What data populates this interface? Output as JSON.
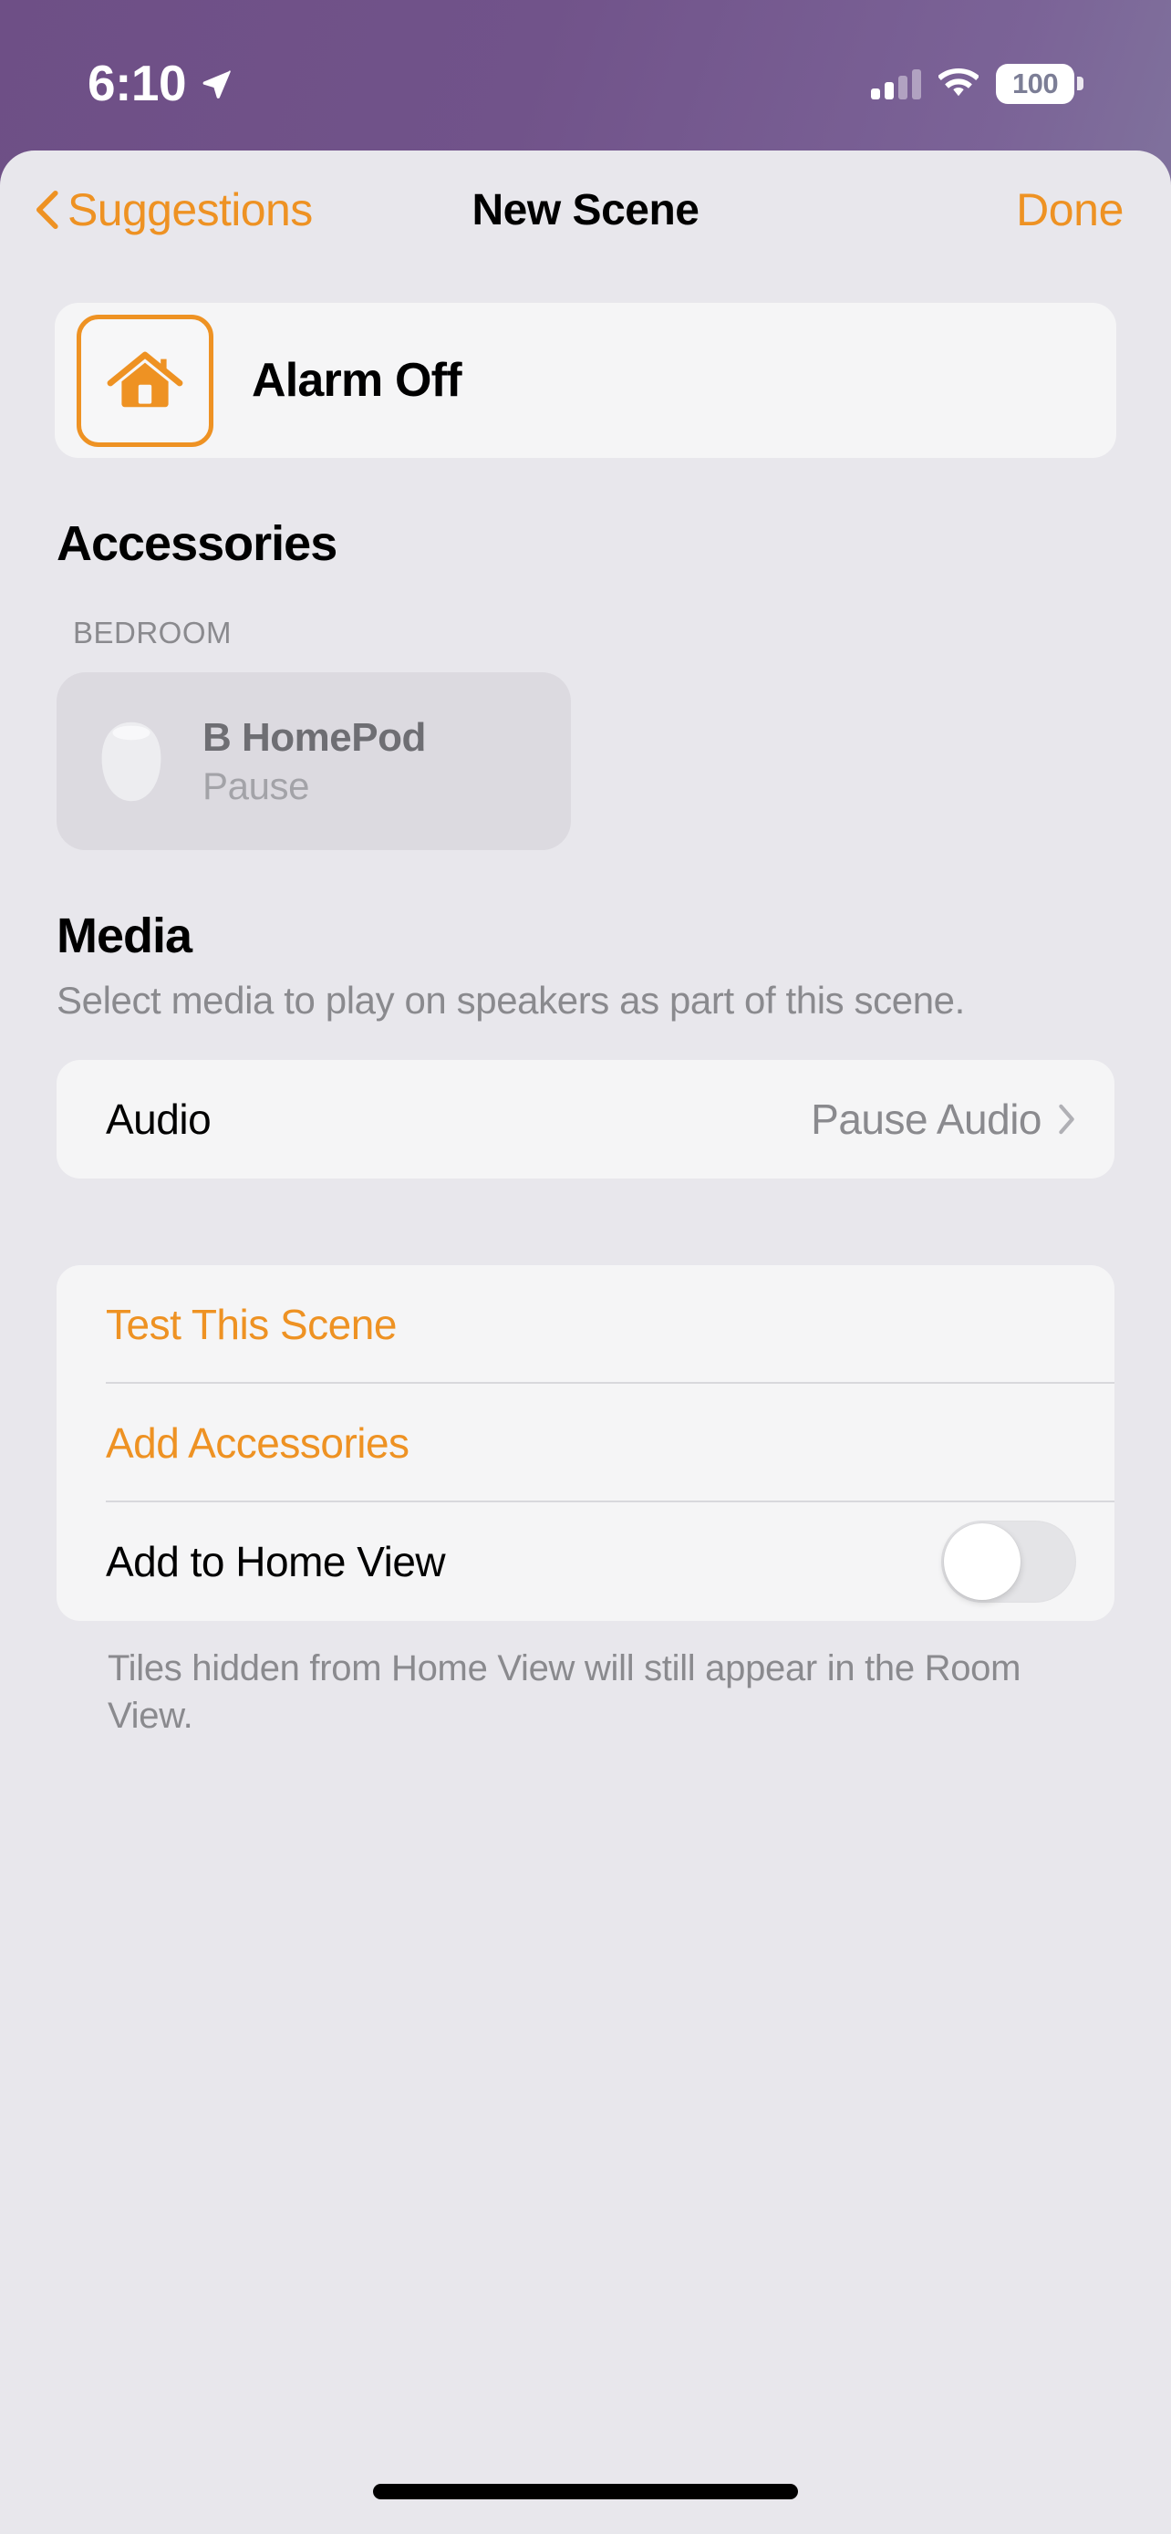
{
  "status_bar": {
    "time": "6:10",
    "location_icon": "location-arrow-icon",
    "cellular_icon": "cellular-signal-icon",
    "cellular_bars_filled": 2,
    "cellular_bars_total": 4,
    "wifi_icon": "wifi-icon",
    "battery_icon": "battery-icon",
    "battery_level": "100"
  },
  "nav": {
    "back_icon": "chevron-left-icon",
    "back_label": "Suggestions",
    "title": "New Scene",
    "done_label": "Done"
  },
  "scene": {
    "icon": "house-icon",
    "name": "Alarm Off"
  },
  "accessories": {
    "heading": "Accessories",
    "groups": [
      {
        "room": "BEDROOM",
        "items": [
          {
            "icon": "homepod-icon",
            "name": "B HomePod",
            "state": "Pause"
          }
        ]
      }
    ]
  },
  "media": {
    "heading": "Media",
    "subtitle": "Select media to play on speakers as part of this scene.",
    "rows": [
      {
        "label": "Audio",
        "value": "Pause Audio",
        "chevron_icon": "chevron-right-icon"
      }
    ]
  },
  "actions": {
    "test_scene_label": "Test This Scene",
    "add_accessories_label": "Add Accessories",
    "add_to_home_view_label": "Add to Home View",
    "add_to_home_view_on": false,
    "footnote": "Tiles hidden from Home View will still appear in the Room View."
  },
  "colors": {
    "accent_orange": "#EE9223",
    "page_background": "#E8E7EC",
    "card_background": "#F5F5F6",
    "tile_background": "#DCDAE0",
    "secondary_text": "#8A8A8E",
    "wallpaper_purple": "#6E4F86"
  }
}
